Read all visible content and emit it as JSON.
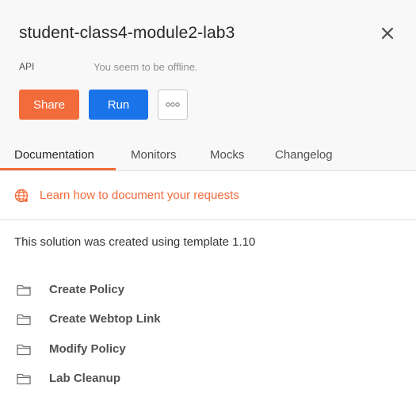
{
  "collection": {
    "title": "student-class4-module2-lab3",
    "meta_label": "API",
    "status": "You seem to be offline."
  },
  "actions": {
    "share_label": "Share",
    "run_label": "Run",
    "more_icon": "more-horizontal-icon"
  },
  "tabs": [
    {
      "label": "Documentation",
      "active": true
    },
    {
      "label": "Monitors",
      "active": false
    },
    {
      "label": "Mocks",
      "active": false
    },
    {
      "label": "Changelog",
      "active": false
    }
  ],
  "learn": {
    "icon": "globe-icon",
    "label": "Learn how to document your requests"
  },
  "description": "This solution was created using template 1.10",
  "folders": [
    {
      "label": "Create Policy"
    },
    {
      "label": "Create Webtop Link"
    },
    {
      "label": "Modify Policy"
    },
    {
      "label": "Lab Cleanup"
    }
  ],
  "colors": {
    "accent": "#f26b3a",
    "primary": "#1a73e8",
    "header_bg": "#f8f8f8"
  }
}
